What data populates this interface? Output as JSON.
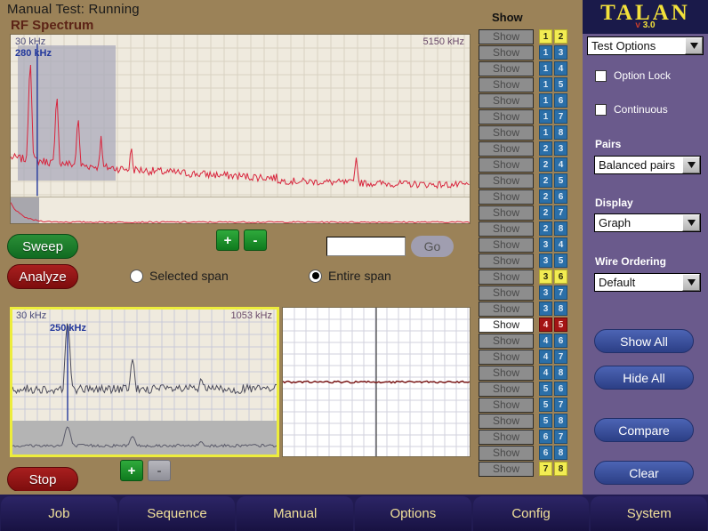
{
  "header": {
    "status": "Manual Test: Running",
    "title": "RF Spectrum"
  },
  "top_chart": {
    "freq_start": "30 kHz",
    "freq_end": "5150 kHz",
    "marker": "280 kHz"
  },
  "bottom_left_chart": {
    "freq_start": "30 kHz",
    "freq_end": "1053 kHz",
    "marker": "250 kHz"
  },
  "controls": {
    "sweep_label": "Sweep",
    "analyze_label": "Analyze",
    "stop_label": "Stop",
    "zoom_in_label": "+",
    "zoom_out_label": "-",
    "zoom_in2_label": "+",
    "zoom_out2_label": "-",
    "freq_input_value": "",
    "freq_input_placeholder": "",
    "go_label": "Go",
    "radio_selected_span": "Selected span",
    "radio_entire_span": "Entire span",
    "selected_span_checked": false,
    "entire_span_checked": true
  },
  "show_panel": {
    "heading": "Show",
    "button_label": "Show",
    "rows": [
      {
        "a": "1",
        "b": "2",
        "state": "yellow",
        "active": false
      },
      {
        "a": "1",
        "b": "3",
        "state": "blue",
        "active": false
      },
      {
        "a": "1",
        "b": "4",
        "state": "blue",
        "active": false
      },
      {
        "a": "1",
        "b": "5",
        "state": "blue",
        "active": false
      },
      {
        "a": "1",
        "b": "6",
        "state": "blue",
        "active": false
      },
      {
        "a": "1",
        "b": "7",
        "state": "blue",
        "active": false
      },
      {
        "a": "1",
        "b": "8",
        "state": "blue",
        "active": false
      },
      {
        "a": "2",
        "b": "3",
        "state": "blue",
        "active": false
      },
      {
        "a": "2",
        "b": "4",
        "state": "blue",
        "active": false
      },
      {
        "a": "2",
        "b": "5",
        "state": "blue",
        "active": false
      },
      {
        "a": "2",
        "b": "6",
        "state": "blue",
        "active": false
      },
      {
        "a": "2",
        "b": "7",
        "state": "blue",
        "active": false
      },
      {
        "a": "2",
        "b": "8",
        "state": "blue",
        "active": false
      },
      {
        "a": "3",
        "b": "4",
        "state": "blue",
        "active": false
      },
      {
        "a": "3",
        "b": "5",
        "state": "blue",
        "active": false
      },
      {
        "a": "3",
        "b": "6",
        "state": "yellow",
        "active": false
      },
      {
        "a": "3",
        "b": "7",
        "state": "blue",
        "active": false
      },
      {
        "a": "3",
        "b": "8",
        "state": "blue",
        "active": false
      },
      {
        "a": "4",
        "b": "5",
        "state": "red",
        "active": true
      },
      {
        "a": "4",
        "b": "6",
        "state": "blue",
        "active": false
      },
      {
        "a": "4",
        "b": "7",
        "state": "blue",
        "active": false
      },
      {
        "a": "4",
        "b": "8",
        "state": "blue",
        "active": false
      },
      {
        "a": "5",
        "b": "6",
        "state": "blue",
        "active": false
      },
      {
        "a": "5",
        "b": "7",
        "state": "blue",
        "active": false
      },
      {
        "a": "5",
        "b": "8",
        "state": "blue",
        "active": false
      },
      {
        "a": "6",
        "b": "7",
        "state": "blue",
        "active": false
      },
      {
        "a": "6",
        "b": "8",
        "state": "blue",
        "active": false
      },
      {
        "a": "7",
        "b": "8",
        "state": "yellow",
        "active": false
      }
    ]
  },
  "right_panel": {
    "logo_word": "TALAN",
    "logo_version_v": "v",
    "logo_version_num": "3.0",
    "test_options_value": "Test Options",
    "option_lock_label": "Option Lock",
    "option_lock_checked": false,
    "continuous_label": "Continuous",
    "continuous_checked": false,
    "pairs_label": "Pairs",
    "pairs_value": "Balanced pairs",
    "display_label": "Display",
    "display_value": "Graph",
    "wire_ordering_label": "Wire Ordering",
    "wire_ordering_value": "Default",
    "show_all_label": "Show All",
    "hide_all_label": "Hide All",
    "compare_label": "Compare",
    "clear_label": "Clear"
  },
  "nav": {
    "tabs": [
      {
        "label": "Job"
      },
      {
        "label": "Sequence"
      },
      {
        "label": "Manual"
      },
      {
        "label": "Options"
      },
      {
        "label": "Config"
      },
      {
        "label": "System"
      }
    ]
  },
  "colors": {
    "background": "#9b8258",
    "panel": "#6a5a8c",
    "navy": "#211b52",
    "accent_yellow": "#f2e03a",
    "trace_red": "#d8243c",
    "marker_blue": "#23389c",
    "title_red": "#5c2316"
  }
}
